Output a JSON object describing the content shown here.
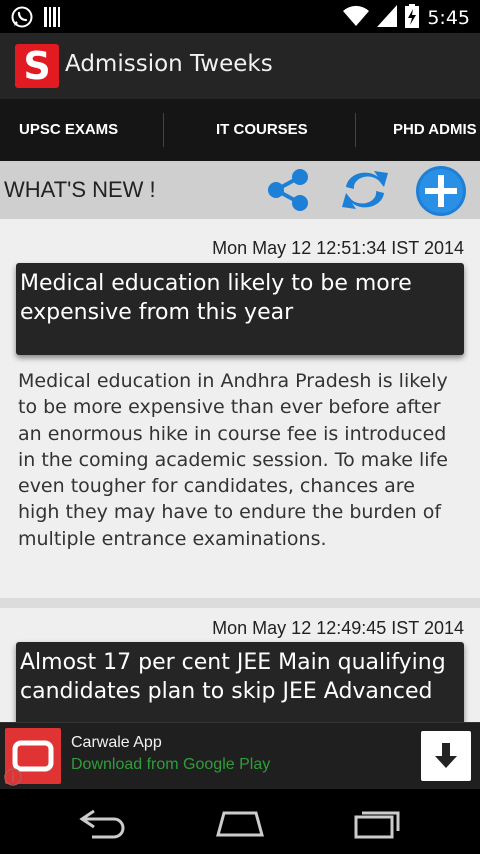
{
  "status_bar": {
    "time": "5:45",
    "icons": [
      "whatsapp-icon",
      "barcode-icon",
      "wifi-icon",
      "signal-icon",
      "battery-charging-icon"
    ]
  },
  "app_bar": {
    "logo_letter": "S",
    "title": "Admission Tweeks",
    "brand_color": "#e21b22"
  },
  "tabs": [
    {
      "label": "UPSC EXAMS"
    },
    {
      "label": "IT COURSES"
    },
    {
      "label": "PHD ADMIS"
    }
  ],
  "toolbar": {
    "section_title": "WHAT'S NEW !",
    "icons": [
      "share-icon",
      "refresh-icon",
      "add-icon"
    ],
    "accent_color": "#1e7fd6"
  },
  "feed": [
    {
      "date": "Mon May 12 12:51:34 IST 2014",
      "headline": "Medical education likely to be more expensive from this year",
      "body": "Medical education in Andhra Pradesh is likely to be more expensive than ever before after an enormous hike in course fee is introduced in the coming academic session. To make life even tougher for candidates, chances are high they may have to endure the burden of multiple entrance examinations."
    },
    {
      "date": "Mon May 12 12:49:45 IST 2014",
      "headline": "Almost 17 per cent JEE Main qualifying candidates plan to skip JEE Advanced"
    }
  ],
  "ad_banner": {
    "title": "Carwale App",
    "subtitle": "Download from Google Play",
    "subtitle_color": "#2f9e3a",
    "icons": [
      "carwale-app-icon",
      "download-icon",
      "info-icon"
    ]
  },
  "nav_bar": {
    "icons": [
      "back-icon",
      "home-icon",
      "recents-icon"
    ]
  }
}
